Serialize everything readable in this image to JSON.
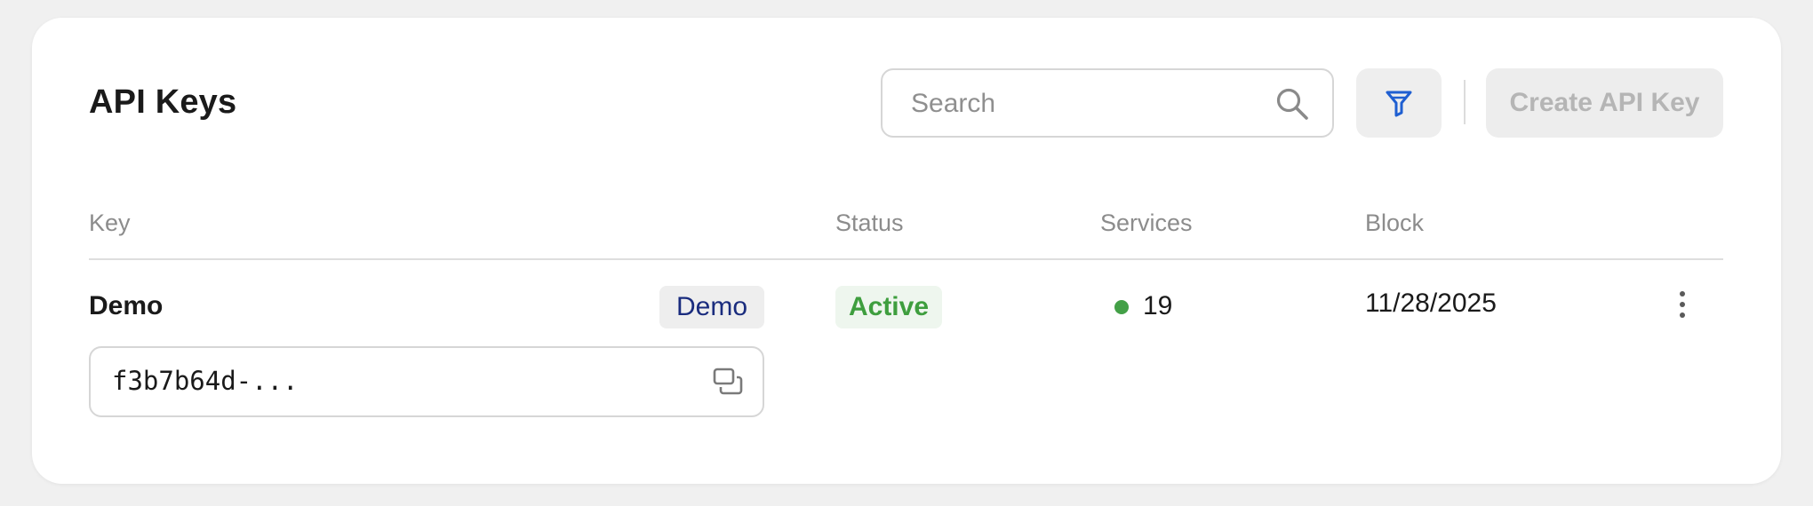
{
  "header": {
    "title": "API Keys",
    "search_placeholder": "Search",
    "search_icon": "search-icon",
    "filter_icon": "filter-icon",
    "create_label": "Create API Key"
  },
  "table": {
    "columns": [
      "Key",
      "Status",
      "Services",
      "Block"
    ],
    "rows": [
      {
        "name": "Demo",
        "tag": "Demo",
        "key_value": "f3b7b64d-...",
        "status": "Active",
        "services": "19",
        "block": "11/28/2025"
      }
    ]
  },
  "colors": {
    "accent": "#1f5fd1",
    "status_active": "#3e9e3e",
    "tag_text": "#1a2c7e"
  }
}
